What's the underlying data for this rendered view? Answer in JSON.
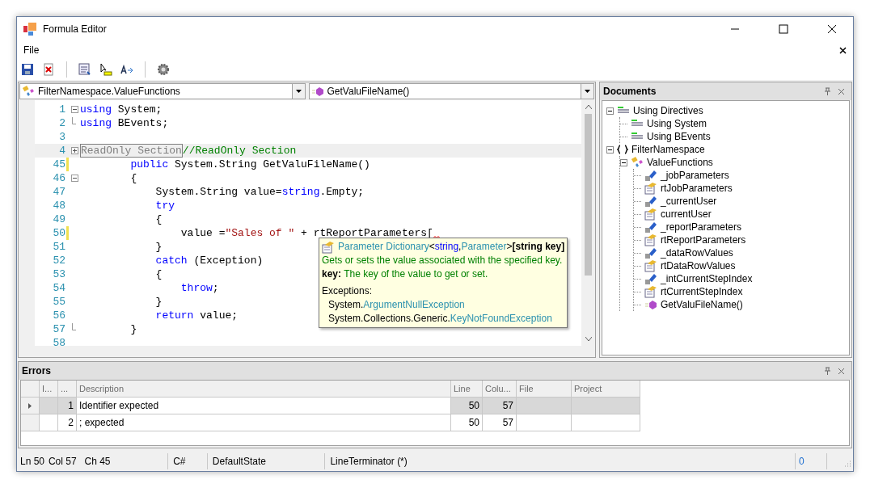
{
  "window": {
    "title": "Formula Editor"
  },
  "menu": [
    {
      "label": "File"
    }
  ],
  "toolbar": [
    {
      "kind": "save"
    },
    {
      "kind": "close-doc"
    },
    {
      "kind": "sep"
    },
    {
      "kind": "list"
    },
    {
      "kind": "cursor"
    },
    {
      "kind": "font"
    },
    {
      "kind": "sep"
    },
    {
      "kind": "gear"
    }
  ],
  "editor": {
    "type_combo": {
      "value": "FilterNamespace.ValueFunctions"
    },
    "member_combo": {
      "value": "GetValuFileName()"
    },
    "lines": [
      {
        "number": "1",
        "collapsible": true,
        "expanded": true,
        "modified": false,
        "tokens": [
          {
            "kind": "keyword",
            "text": "using"
          },
          {
            "kind": "plain",
            "text": " System;"
          }
        ]
      },
      {
        "number": "2",
        "fold_end": true,
        "modified": false,
        "tokens": [
          {
            "kind": "keyword",
            "text": "using"
          },
          {
            "kind": "plain",
            "text": " BEvents;"
          }
        ]
      },
      {
        "number": "3",
        "modified": false
      },
      {
        "number": "4",
        "collapsible": true,
        "expanded": false,
        "modified": false,
        "highlight": true,
        "tokens": [
          {
            "kind": "collapsed",
            "text": "ReadOnly Section"
          },
          {
            "kind": "comment",
            "text": "//ReadOnly Section"
          }
        ]
      },
      {
        "number": "45",
        "modified": true,
        "tokens": [
          {
            "kind": "keyword",
            "text": "        public"
          },
          {
            "kind": "plain",
            "text": " System.String GetValuFileName()"
          }
        ]
      },
      {
        "number": "46",
        "collapsible": true,
        "expanded": true,
        "modified": false,
        "tokens": [
          {
            "kind": "plain",
            "text": "        {"
          }
        ]
      },
      {
        "number": "47",
        "modified": false,
        "tokens": [
          {
            "kind": "plain",
            "text": "            System.String value="
          },
          {
            "kind": "keyword",
            "text": "string"
          },
          {
            "kind": "plain",
            "text": ".Empty;"
          }
        ]
      },
      {
        "number": "48",
        "modified": false,
        "tokens": [
          {
            "kind": "keyword",
            "text": "            try"
          }
        ]
      },
      {
        "number": "49",
        "modified": false,
        "tokens": [
          {
            "kind": "plain",
            "text": "            {"
          }
        ]
      },
      {
        "number": "50",
        "modified": true,
        "error": true,
        "tokens": [
          {
            "kind": "plain",
            "text": "                value ="
          },
          {
            "kind": "string",
            "text": "\"Sales of \""
          },
          {
            "kind": "plain",
            "text": " + rtReportParameters["
          }
        ]
      },
      {
        "number": "51",
        "modified": false,
        "tokens": [
          {
            "kind": "plain",
            "text": "            }"
          }
        ]
      },
      {
        "number": "52",
        "modified": false,
        "tokens": [
          {
            "kind": "keyword",
            "text": "            catch"
          },
          {
            "kind": "plain",
            "text": " (Exception)"
          }
        ]
      },
      {
        "number": "53",
        "modified": false,
        "tokens": [
          {
            "kind": "plain",
            "text": "            {"
          }
        ]
      },
      {
        "number": "54",
        "modified": false,
        "tokens": [
          {
            "kind": "keyword",
            "text": "                throw"
          },
          {
            "kind": "plain",
            "text": ";"
          }
        ]
      },
      {
        "number": "55",
        "modified": false,
        "tokens": [
          {
            "kind": "plain",
            "text": "            }"
          }
        ]
      },
      {
        "number": "56",
        "modified": false,
        "tokens": [
          {
            "kind": "keyword",
            "text": "            return"
          },
          {
            "kind": "plain",
            "text": " value;"
          }
        ]
      },
      {
        "number": "57",
        "fold_end": true,
        "modified": false,
        "tokens": [
          {
            "kind": "plain",
            "text": "        }"
          }
        ]
      },
      {
        "number": "58",
        "modified": false
      }
    ],
    "tooltip": {
      "signature": [
        {
          "kind": "type",
          "text": "Parameter Dictionary"
        },
        {
          "kind": "plain",
          "text": "<"
        },
        {
          "kind": "keyword",
          "text": "string"
        },
        {
          "kind": "plain",
          "text": ","
        },
        {
          "kind": "type",
          "text": "Parameter"
        },
        {
          "kind": "plain",
          "text": ">"
        },
        {
          "kind": "bold",
          "text": "[string key]"
        }
      ],
      "summary": "Gets or sets the value associated with the specified key.",
      "param_name": "key:",
      "param_desc": "The key of the value to get or set.",
      "exceptions_label": "Exceptions:",
      "exceptions": [
        {
          "namespace": "System.",
          "name": "ArgumentNullException"
        },
        {
          "namespace": "System.Collections.Generic.",
          "name": "KeyNotFoundException"
        }
      ]
    }
  },
  "documents": {
    "title": "Documents",
    "tree": [
      {
        "label": "Using Directives",
        "kind": "usings",
        "expanded": true,
        "children": [
          {
            "label": "Using System",
            "kind": "using"
          },
          {
            "label": "Using BEvents",
            "kind": "using"
          }
        ]
      },
      {
        "label": "FilterNamespace",
        "kind": "namespace",
        "expanded": true,
        "children": [
          {
            "label": "ValueFunctions",
            "kind": "class",
            "expanded": true,
            "children": [
              {
                "label": "_jobParameters",
                "kind": "field"
              },
              {
                "label": "rtJobParameters",
                "kind": "property"
              },
              {
                "label": "_currentUser",
                "kind": "field"
              },
              {
                "label": "currentUser",
                "kind": "property"
              },
              {
                "label": "_reportParameters",
                "kind": "field"
              },
              {
                "label": "rtReportParameters",
                "kind": "property"
              },
              {
                "label": "_dataRowValues",
                "kind": "field"
              },
              {
                "label": "rtDataRowValues",
                "kind": "property"
              },
              {
                "label": "_intCurrentStepIndex",
                "kind": "field"
              },
              {
                "label": "rtCurrentStepIndex",
                "kind": "property"
              },
              {
                "label": "GetValuFileName()",
                "kind": "method"
              }
            ]
          }
        ]
      }
    ]
  },
  "errors": {
    "title": "Errors",
    "columns": [
      "I...",
      "...",
      "Description",
      "Line",
      "Colu...",
      "File",
      "Project"
    ],
    "rows": [
      {
        "selected": true,
        "cells": [
          "",
          "1",
          "Identifier expected",
          "50",
          "57",
          "",
          ""
        ]
      },
      {
        "selected": false,
        "cells": [
          "",
          "2",
          "; expected",
          "50",
          "57",
          "",
          ""
        ]
      }
    ]
  },
  "status_bar": [
    "Ln 50",
    "Col 57",
    "Ch 45",
    "C#",
    "DefaultState",
    "LineTerminator (*)",
    "0"
  ]
}
